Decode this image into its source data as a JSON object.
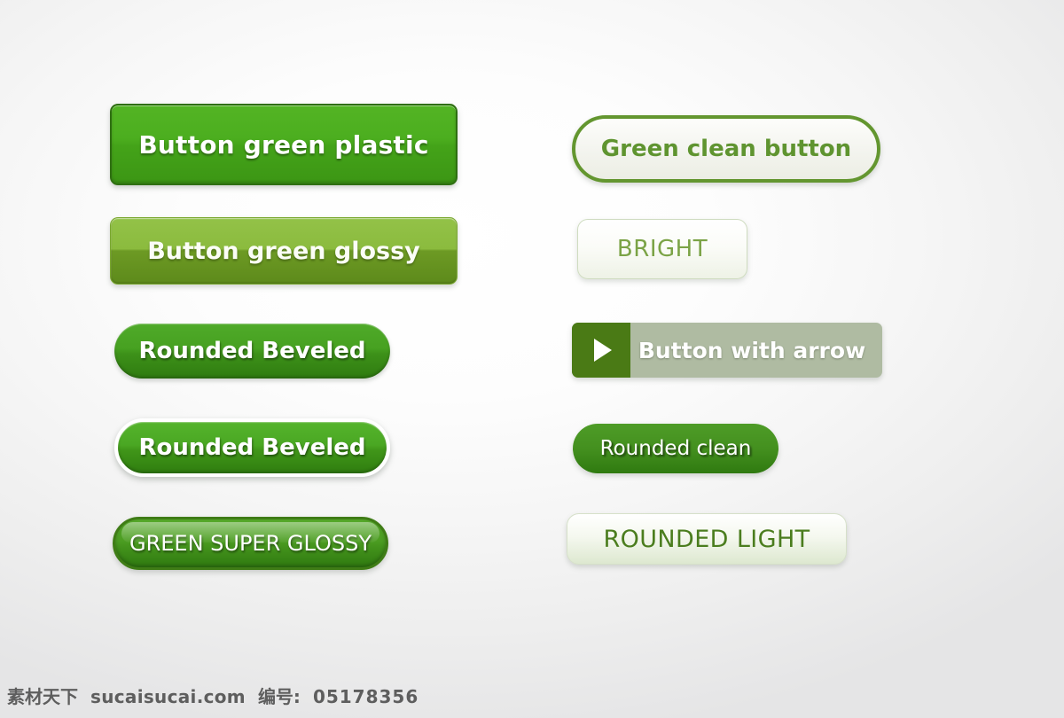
{
  "page": {
    "background_start": "#ffffff",
    "background_end": "#e5e5e6"
  },
  "buttons": {
    "left_column": [
      {
        "label": "Button green plastic",
        "style": "plastic-rect",
        "accent": "#4cae1f"
      },
      {
        "label": "Button green glossy",
        "style": "glossy-rect",
        "accent": "#8bbb3e"
      },
      {
        "label": "Rounded Beveled",
        "style": "rounded-beveled",
        "accent": "#47a121"
      },
      {
        "label": "Rounded Beveled",
        "style": "rounded-beveled-ring",
        "accent": "#4aa723"
      },
      {
        "label": "GREEN SUPER GLOSSY",
        "style": "super-glossy",
        "accent": "#4c9d22"
      }
    ],
    "right_column": [
      {
        "label": "Green clean button",
        "style": "clean-outline",
        "accent": "#63962f"
      },
      {
        "label": "BRIGHT",
        "style": "bright-light",
        "accent": "#7ba346"
      },
      {
        "label": "Button with arrow",
        "style": "arrow-split",
        "accent": "#4a7a15",
        "icon": "play-arrow-icon"
      },
      {
        "label": "Rounded clean",
        "style": "rounded-clean",
        "accent": "#44901f"
      },
      {
        "label": "ROUNDED LIGHT",
        "style": "rounded-light",
        "accent": "#4b7d1e"
      }
    ]
  },
  "footer": {
    "site_name": "素材天下",
    "site_url": "sucaisucai.com",
    "id_label": "编号:",
    "id_value": "05178356"
  }
}
